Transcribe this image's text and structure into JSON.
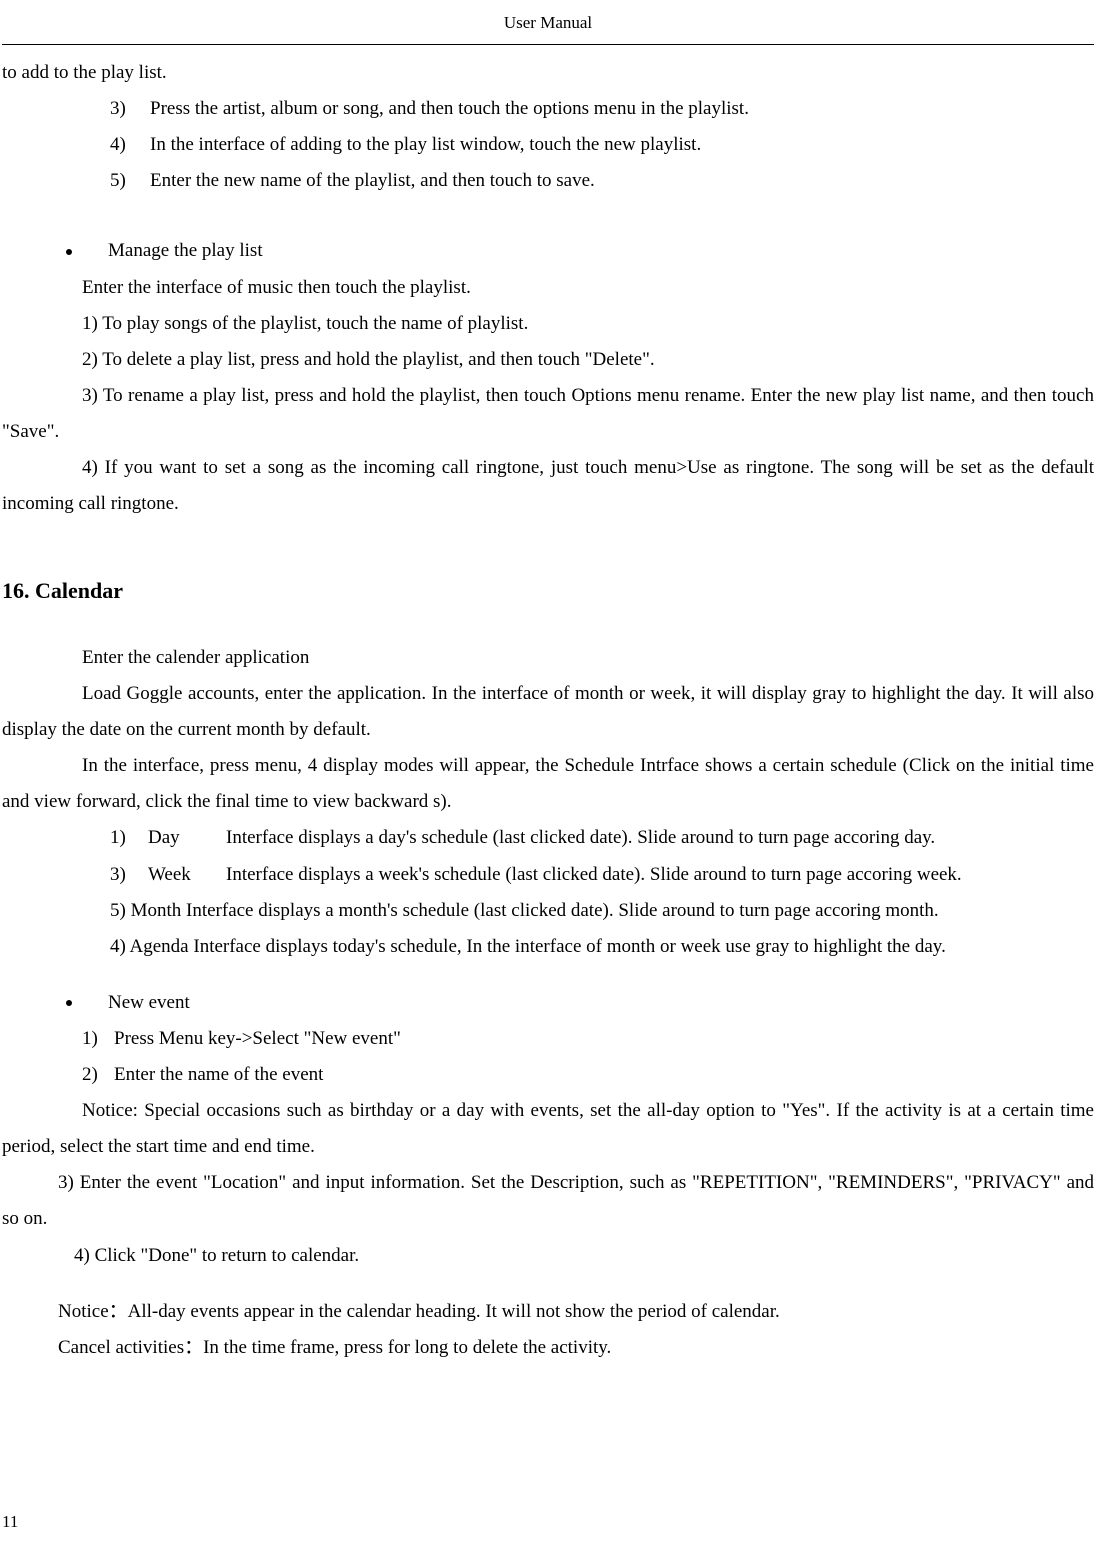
{
  "header": {
    "title": "User Manual"
  },
  "s1": {
    "frag": "to add to the play list.",
    "l3n": "3)",
    "l3": "Press the artist, album or song, and then touch the options menu in the playlist.",
    "l4n": "4)",
    "l4": "In the interface of adding to the play list window, touch the new playlist.",
    "l5n": "5)",
    "l5": "Enter the new name of the playlist, and then touch to save."
  },
  "manage": {
    "title": "Manage the play list",
    "intro": "Enter the interface of music then touch the playlist.",
    "i1": "1) To play songs of the playlist, touch the name of playlist.",
    "i2": "2) To delete a play list, press and hold the playlist, and then touch \"Delete\".",
    "i3": "3) To rename a play list, press and hold the playlist, then touch Options menu rename. Enter the new play list name, and then touch \"Save\".",
    "i4": "4) If you want to set a song as the incoming call ringtone, just touch menu>Use as ringtone. The song will be set as the default incoming call ringtone."
  },
  "cal": {
    "heading": "16. Calendar",
    "p1": "Enter the calender application",
    "p2": "Load Goggle accounts, enter the application. In the interface of month or week, it will display gray to highlight the day. It will also display the date on the current month by default.",
    "p3": "In the interface, press menu, 4 display modes will appear, the Schedule Intrface shows a certain schedule (Click on the initial time and view forward, click the final time to view backward s).",
    "r1n": "1)",
    "r1k": "Day",
    "r1t": "Interface displays a day's schedule (last clicked date). Slide around to turn page accoring day.",
    "r3n": "3)",
    "r3k": "Week",
    "r3t": "Interface displays a week's schedule (last clicked date). Slide around to turn page accoring week.",
    "r5n": "5)",
    "r5k": "Month",
    "r5line": "5)    Month     Interface  displays  a  month's  schedule  (last  clicked  date).  Slide  around  to  turn  page  accoring month.",
    "r4line": "4)    Agenda      Interface displays today's schedule, In the interface of month or week use gray to highlight the day."
  },
  "ev": {
    "title": "New event",
    "e1n": "1)",
    "e1": "Press Menu key->Select \"New event\"",
    "e2n": "2)",
    "e2": "Enter the name of the event",
    "notice1": "Notice: Special occasions such as birthday or a day with events, set the all-day option to \"Yes\". If the activity is at a certain time period, select the start time and end time.",
    "e3": "3)   Enter the event \"Location\" and input information. Set the Description, such as \"REPETITION\", \"REMINDERS\", \"PRIVACY\" and so on.",
    "e4": "4) Click \"Done\" to return to calendar.",
    "n2": "Notice：All-day events appear in the calendar heading. It will not show the period of calendar.",
    "n3": "Cancel activities：In the time frame, press for long to delete the activity."
  },
  "page": {
    "num": "11"
  }
}
